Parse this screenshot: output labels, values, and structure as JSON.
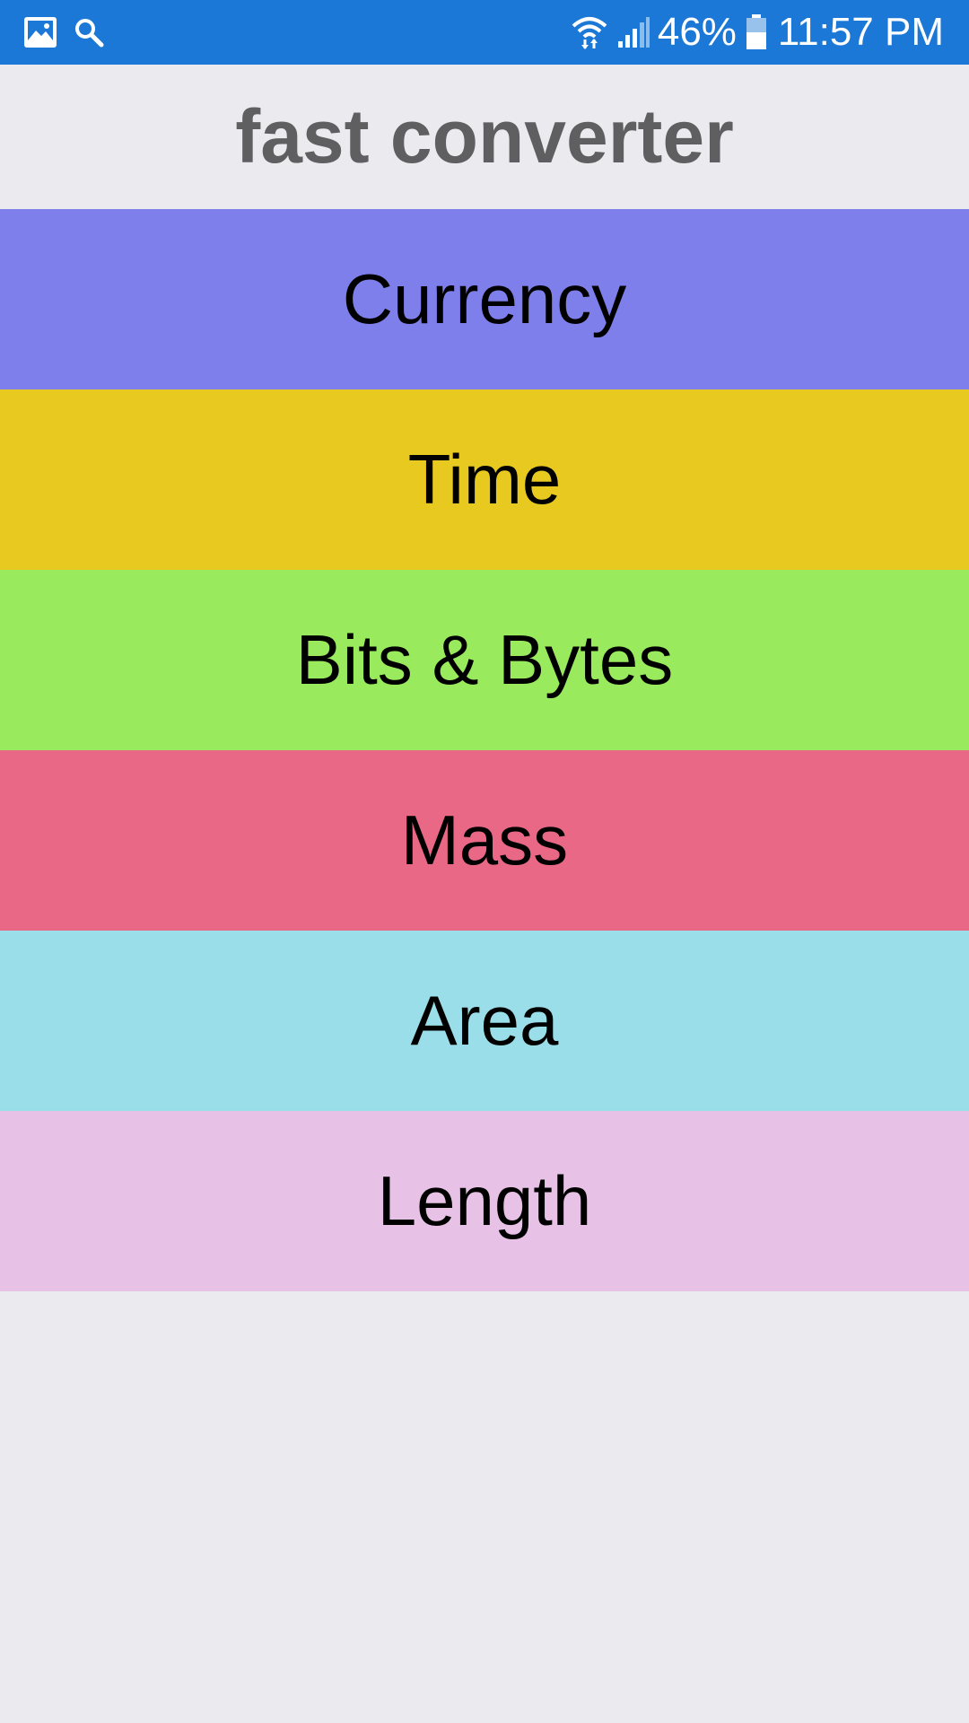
{
  "status_bar": {
    "left_icons": [
      "image-icon",
      "search-icon"
    ],
    "right_icons": [
      "wifi-icon",
      "signal-icon",
      "battery-icon"
    ],
    "battery_percent": "46%",
    "time": "11:57 PM",
    "background_color": "#1b78d6"
  },
  "header": {
    "title": "fast converter",
    "title_color": "#5f5f62"
  },
  "categories": [
    {
      "label": "Currency",
      "color": "#7e7fea"
    },
    {
      "label": "Time",
      "color": "#e8c91f"
    },
    {
      "label": "Bits & Bytes",
      "color": "#9aea5e"
    },
    {
      "label": "Mass",
      "color": "#e96885"
    },
    {
      "label": "Area",
      "color": "#9adee9"
    },
    {
      "label": "Length",
      "color": "#e7c2e6"
    }
  ],
  "page_background": "#ebebef"
}
